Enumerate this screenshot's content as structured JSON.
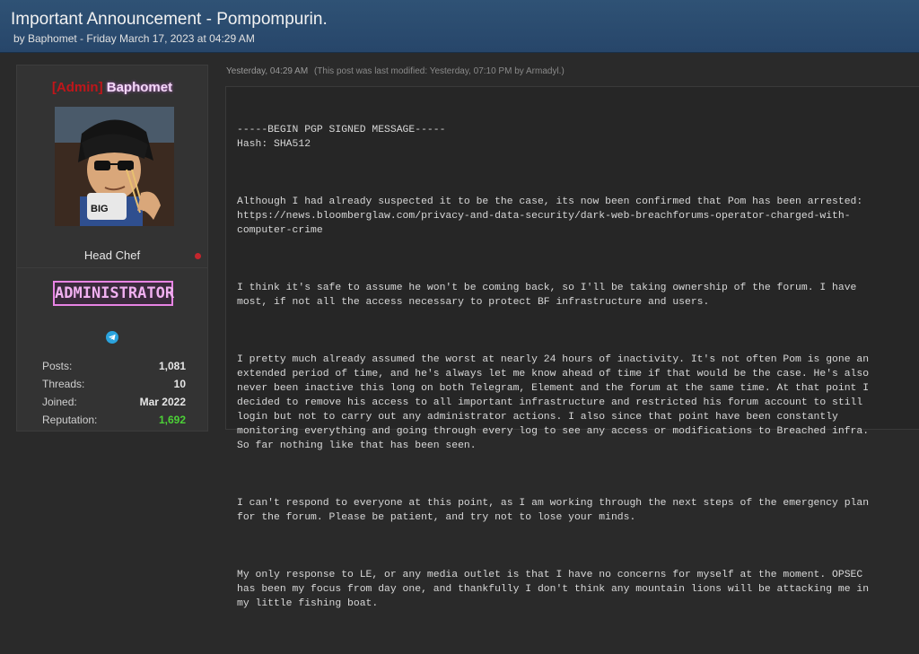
{
  "header": {
    "title": "Important Announcement - Pompompurin.",
    "byline": "by Baphomet - Friday March 17, 2023 at 04:29 AM"
  },
  "user": {
    "tag": "[Admin]",
    "name": "Baphomet",
    "title": "Head Chef",
    "badge": "ADMINISTRATOR",
    "contact_icon": "telegram-icon",
    "online_status_color": "#c4262d",
    "stats": [
      {
        "label": "Posts:",
        "value": "1,081"
      },
      {
        "label": "Threads:",
        "value": "10"
      },
      {
        "label": "Joined:",
        "value": "Mar 2022"
      },
      {
        "label": "Reputation:",
        "value": "1,692"
      }
    ]
  },
  "post": {
    "time": "Yesterday, 04:29 AM",
    "modified": "(This post was last modified: Yesterday, 07:10 PM by Armadyl.)",
    "paragraphs": [
      "-----BEGIN PGP SIGNED MESSAGE-----\nHash: SHA512",
      "Although I had already suspected it to be the case, its now been confirmed that Pom has been arrested:\nhttps://news.bloomberglaw.com/privacy-and-data-security/dark-web-breachforums-operator-charged-with-\ncomputer-crime",
      "I think it's safe to assume he won't be coming back, so I'll be taking ownership of the forum. I have\nmost, if not all the access necessary to protect BF infrastructure and users.",
      "I pretty much already assumed the worst at nearly 24 hours of inactivity. It's not often Pom is gone an\nextended period of time, and he's always let me know ahead of time if that would be the case. He's also\nnever been inactive this long on both Telegram, Element and the forum at the same time. At that point I\ndecided to remove his access to all important infrastructure and restricted his forum account to still\nlogin but not to carry out any administrator actions. I also since that point have been constantly\nmonitoring everything and going through every log to see any access or modifications to Breached infra.\nSo far nothing like that has been seen.",
      "I can't respond to everyone at this point, as I am working through the next steps of the emergency plan\nfor the forum. Please be patient, and try not to lose your minds.",
      "My only response to LE, or any media outlet is that I have no concerns for myself at the moment. OPSEC\nhas been my focus from day one, and thankfully I don't think any mountain lions will be attacking me in\nmy little fishing boat."
    ]
  }
}
